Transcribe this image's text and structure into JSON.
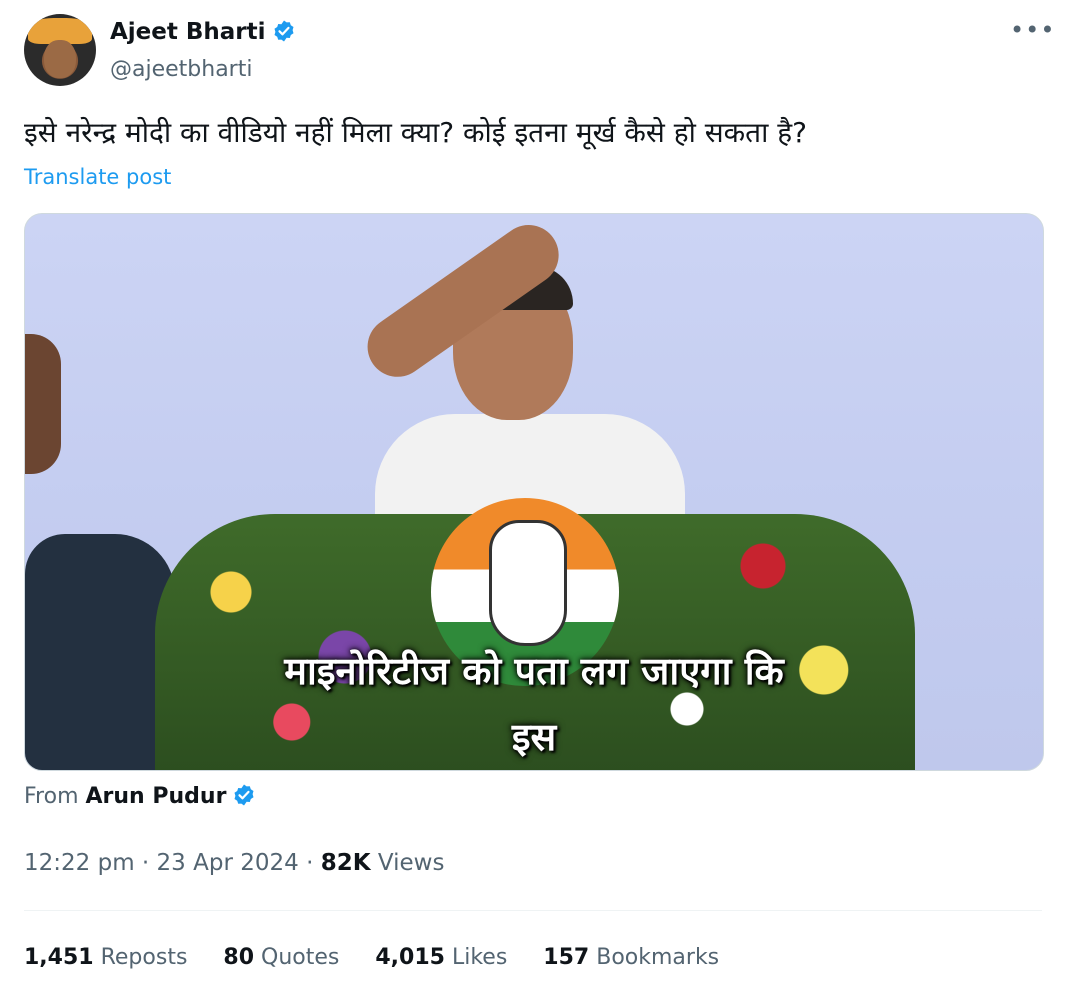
{
  "author": {
    "display_name": "Ajeet Bharti",
    "handle": "@ajeetbharti",
    "verified_icon": "verified-badge-icon"
  },
  "tweet": {
    "text": "इसे नरेन्द्र मोदी का वीडियो नहीं मिला क्या? कोई इतना मूर्ख कैसे हो सकता है?",
    "translate_label": "Translate post"
  },
  "media": {
    "caption_line1": "माइनोरिटीज को पता लग जाएगा कि",
    "caption_line2": "इस"
  },
  "source": {
    "prefix": "From",
    "name": "Arun Pudur"
  },
  "meta": {
    "time": "12:22 pm",
    "date": "23 Apr 2024",
    "views_count": "82K",
    "views_label": "Views"
  },
  "stats": {
    "reposts_count": "1,451",
    "reposts_label": "Reposts",
    "quotes_count": "80",
    "quotes_label": "Quotes",
    "likes_count": "4,015",
    "likes_label": "Likes",
    "bookmarks_count": "157",
    "bookmarks_label": "Bookmarks"
  },
  "colors": {
    "link": "#1d9bf0",
    "secondary_text": "#536471",
    "primary_text": "#0f1419"
  }
}
